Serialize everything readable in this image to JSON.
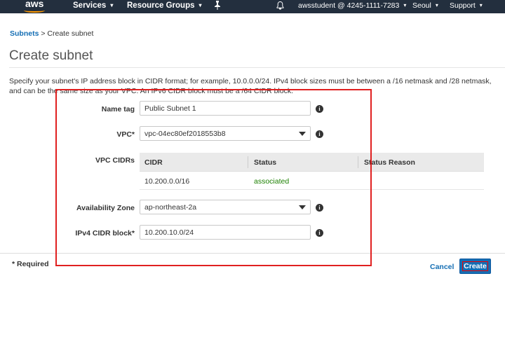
{
  "nav": {
    "logo": "aws",
    "services": "Services",
    "resource_groups": "Resource Groups",
    "account": "awsstudent @ 4245-1111-7283",
    "region": "Seoul",
    "support": "Support",
    "caret": "▾"
  },
  "breadcrumb": {
    "parent": "Subnets",
    "separator": ">",
    "current": "Create subnet"
  },
  "page": {
    "title": "Create subnet",
    "description": "Specify your subnet's IP address block in CIDR format; for example, 10.0.0.0/24. IPv4 block sizes must be between a /16 netmask and /28 netmask, and can be the same size as your VPC. An IPv6 CIDR block must be a /64 CIDR block."
  },
  "form": {
    "name_tag": {
      "label": "Name tag",
      "value": "Public Subnet 1"
    },
    "vpc": {
      "label": "VPC*",
      "value": "vpc-04ec80ef2018553b8"
    },
    "vpc_cidrs": {
      "label": "VPC CIDRs",
      "headers": [
        "CIDR",
        "Status",
        "Status Reason"
      ],
      "rows": [
        {
          "cidr": "10.200.0.0/16",
          "status": "associated",
          "status_reason": ""
        }
      ]
    },
    "availability_zone": {
      "label": "Availability Zone",
      "value": "ap-northeast-2a"
    },
    "ipv4_cidr": {
      "label": "IPv4 CIDR block*",
      "value": "10.200.10.0/24"
    },
    "info_glyph": "i"
  },
  "footer": {
    "required": "* Required",
    "cancel": "Cancel",
    "create": "Create"
  },
  "colors": {
    "nav_bg": "#232f3e",
    "link": "#146eb4",
    "primary_button": "#146eb4",
    "status_ok": "#1d8102",
    "annotation_red": "#e02020"
  }
}
